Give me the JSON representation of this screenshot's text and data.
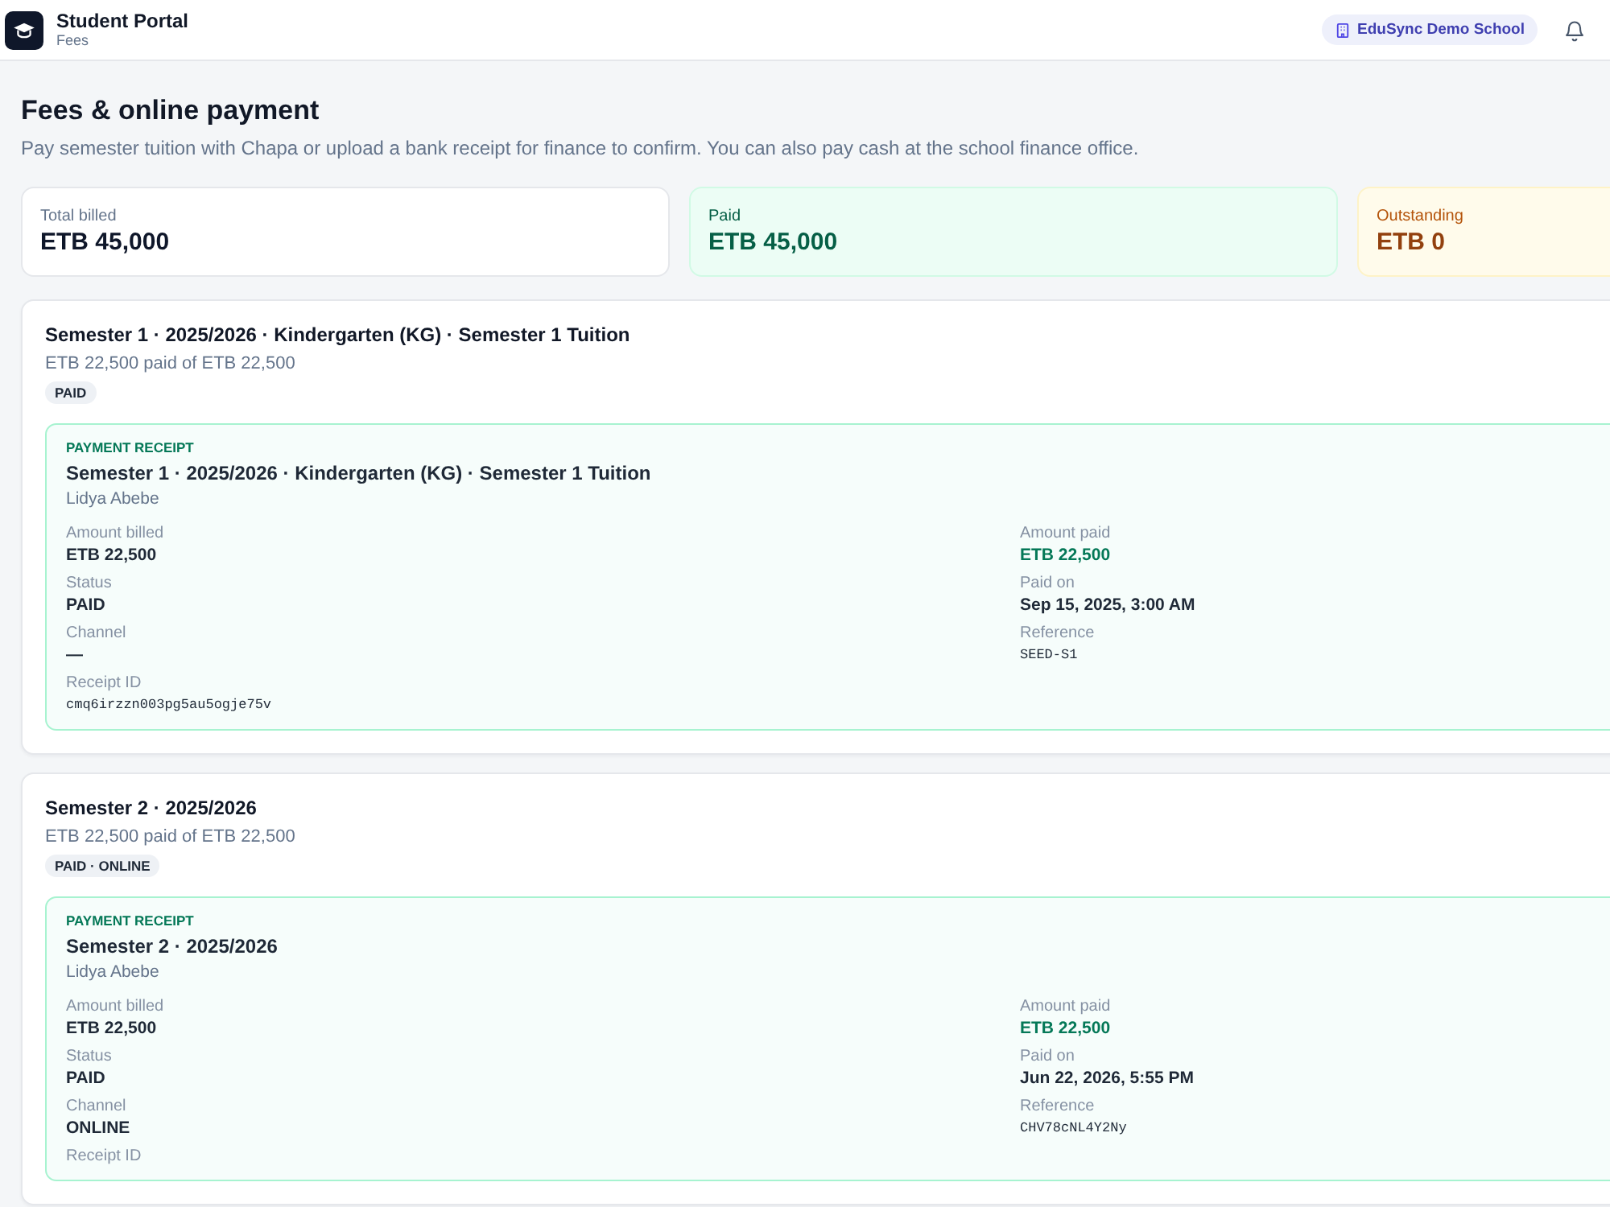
{
  "header": {
    "app_title": "Student Portal",
    "section": "Fees",
    "school_badge": "EduSync Demo School"
  },
  "page": {
    "title": "Fees & online payment",
    "description": "Pay semester tuition with Chapa or upload a bank receipt for finance to confirm. You can also pay cash at the school finance office."
  },
  "summary": [
    {
      "label": "Total billed",
      "value": "ETB 45,000",
      "kind": "total"
    },
    {
      "label": "Paid",
      "value": "ETB 45,000",
      "kind": "paid"
    },
    {
      "label": "Outstanding",
      "value": "ETB 0",
      "kind": "outstanding"
    }
  ],
  "semesters": [
    {
      "title": "Semester 1 · 2025/2026 · Kindergarten (KG) · Semester 1 Tuition",
      "paid_summary": "ETB 22,500 paid of ETB 22,500",
      "status_badge": "PAID",
      "receipt": {
        "heading": "PAYMENT RECEIPT",
        "title": "Semester 1 · 2025/2026 · Kindergarten (KG) · Semester 1 Tuition",
        "student": "Lidya Abebe",
        "fields": [
          {
            "label": "Amount billed",
            "value": "ETB 22,500",
            "kind": "plain"
          },
          {
            "label": "Amount paid",
            "value": "ETB 22,500",
            "kind": "paid"
          },
          {
            "label": "Status",
            "value": "PAID",
            "kind": "plain"
          },
          {
            "label": "Paid on",
            "value": "Sep 15, 2025, 3:00 AM",
            "kind": "plain"
          },
          {
            "label": "Channel",
            "value": "—",
            "kind": "plain"
          },
          {
            "label": "Reference",
            "value": "SEED-S1",
            "kind": "mono"
          },
          {
            "label": "Receipt ID",
            "value": "cmq6irzzn003pg5au5ogje75v",
            "kind": "mono"
          }
        ]
      }
    },
    {
      "title": "Semester 2 · 2025/2026",
      "paid_summary": "ETB 22,500 paid of ETB 22,500",
      "status_badge": "PAID · ONLINE",
      "receipt": {
        "heading": "PAYMENT RECEIPT",
        "title": "Semester 2 · 2025/2026",
        "student": "Lidya Abebe",
        "fields": [
          {
            "label": "Amount billed",
            "value": "ETB 22,500",
            "kind": "plain"
          },
          {
            "label": "Amount paid",
            "value": "ETB 22,500",
            "kind": "paid"
          },
          {
            "label": "Status",
            "value": "PAID",
            "kind": "plain"
          },
          {
            "label": "Paid on",
            "value": "Jun 22, 2026, 5:55 PM",
            "kind": "plain"
          },
          {
            "label": "Channel",
            "value": "ONLINE",
            "kind": "plain"
          },
          {
            "label": "Reference",
            "value": "CHV78cNL4Y2Ny",
            "kind": "mono"
          },
          {
            "label": "Receipt ID"
          }
        ]
      }
    }
  ]
}
